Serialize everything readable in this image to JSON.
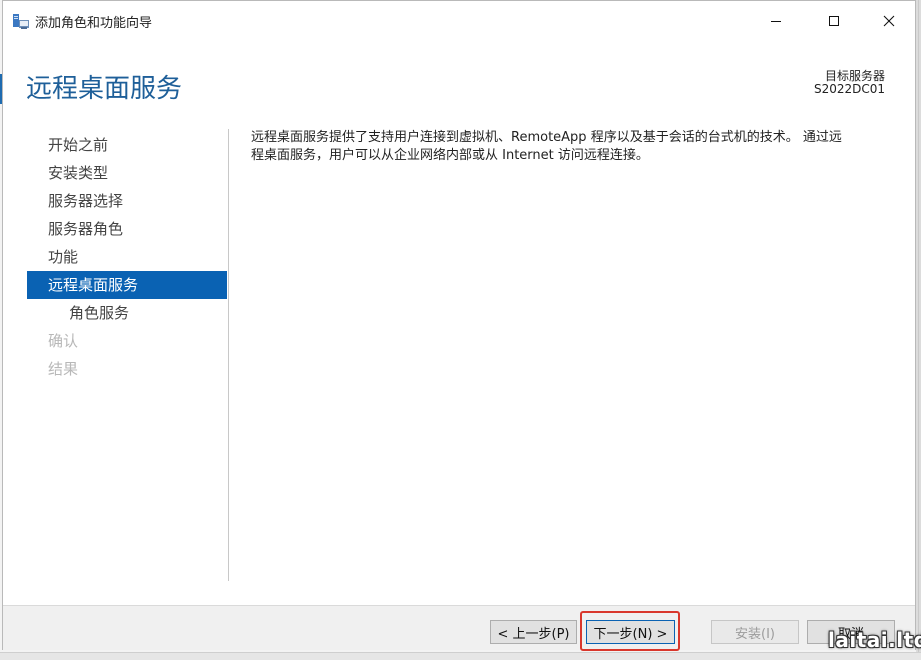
{
  "window": {
    "title": "添加角色和功能向导",
    "icon": "server-manager-icon"
  },
  "header": {
    "page_title": "远程桌面服务",
    "target_label": "目标服务器",
    "target_value": "S2022DC01"
  },
  "nav": {
    "items": [
      {
        "label": "开始之前",
        "state": "normal"
      },
      {
        "label": "安装类型",
        "state": "normal"
      },
      {
        "label": "服务器选择",
        "state": "normal"
      },
      {
        "label": "服务器角色",
        "state": "normal"
      },
      {
        "label": "功能",
        "state": "normal"
      },
      {
        "label": "远程桌面服务",
        "state": "active"
      },
      {
        "label": "角色服务",
        "state": "sub"
      },
      {
        "label": "确认",
        "state": "disabled"
      },
      {
        "label": "结果",
        "state": "disabled"
      }
    ]
  },
  "content": {
    "description_line1": "远程桌面服务提供了支持用户连接到虚拟机、RemoteApp 程序以及基于会话的台式机的技术。 通过远",
    "description_line2": "程桌面服务，用户可以从企业网络内部或从 Internet 访问远程连接。"
  },
  "footer": {
    "prev_label": "< 上一步(P)",
    "next_label": "下一步(N) >",
    "install_label": "安装(I)",
    "cancel_label": "取消"
  },
  "watermark": "laitai.ltd",
  "colors": {
    "accent": "#0a62b3",
    "title": "#1e5f99",
    "highlight": "#d9372c"
  }
}
